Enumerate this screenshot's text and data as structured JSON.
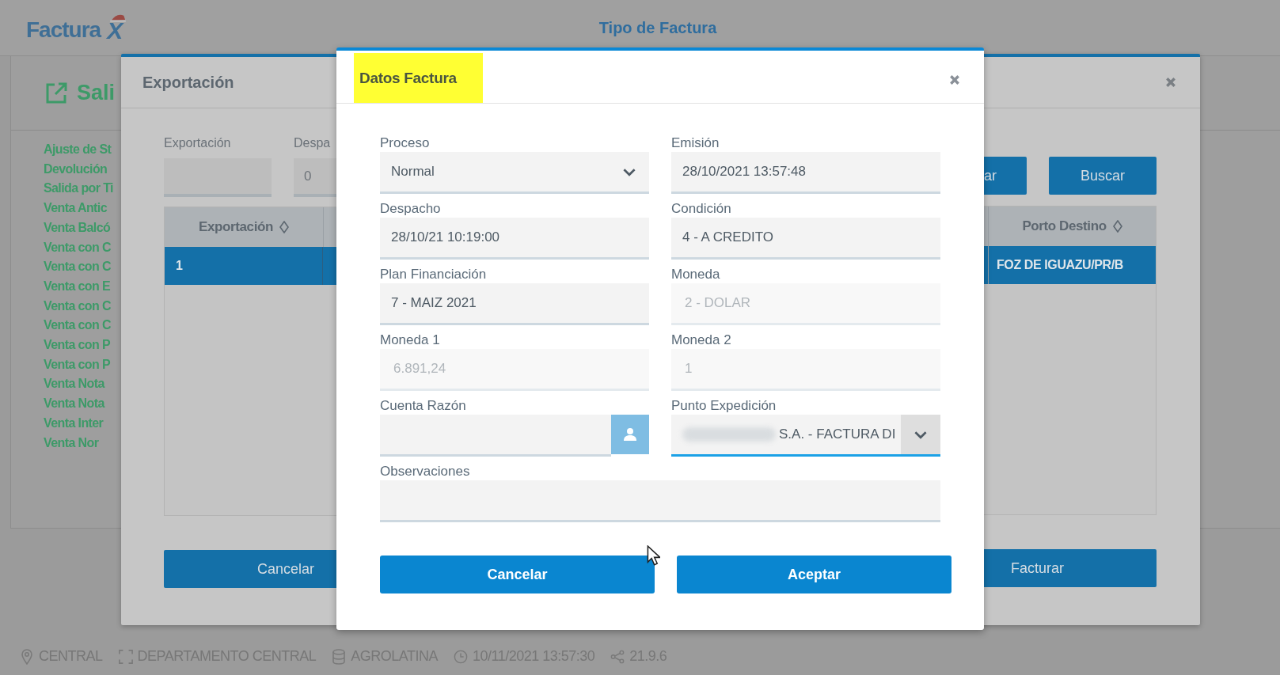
{
  "header": {
    "logo": {
      "text": "Factura",
      "mark": "X"
    },
    "title": "Tipo de Factura"
  },
  "side_panel": {
    "heading": "Sali",
    "items": [
      "Ajuste de St",
      "Devolución",
      "Salida por Ti",
      "Venta Antic",
      "Venta Balcó",
      "Venta con C",
      "Venta con C",
      "Venta con E",
      "Venta con C",
      "Venta con C",
      "Venta con P",
      "Venta con P",
      "Venta Nota",
      "Venta Nota",
      "Venta Inter",
      "Venta Nor"
    ]
  },
  "export_dialog": {
    "title": "Exportación",
    "filters": [
      {
        "label": "Exportación"
      },
      {
        "label": "Despa",
        "value": "0"
      }
    ],
    "actions": [
      "ar",
      "Buscar"
    ],
    "table": {
      "columns": [
        "Exportación",
        "Porto Destino"
      ],
      "rows": [
        {
          "cells": [
            "1",
            "FOZ DE IGUAZU/PR/B"
          ],
          "selected": true
        }
      ]
    },
    "buttons": [
      "Cancelar",
      "Facturar"
    ]
  },
  "invoice_dialog": {
    "title": "Datos Factura",
    "fields": [
      {
        "kind": "select",
        "label": "Proceso",
        "value": "Normal",
        "disabled": false,
        "focused": false,
        "blurred": false
      },
      {
        "kind": "text",
        "label": "Emisión",
        "value": "28/10/2021 13:57:48",
        "disabled": false,
        "focused": false,
        "blurred": false
      },
      {
        "kind": "text",
        "label": "Despacho",
        "value": "28/10/21 10:19:00",
        "disabled": false,
        "focused": false,
        "blurred": false
      },
      {
        "kind": "text",
        "label": "Condición",
        "value": "4 - A CREDITO",
        "disabled": false,
        "focused": false,
        "blurred": false
      },
      {
        "kind": "text",
        "label": "Plan Financiación",
        "value": "7 - MAIZ 2021",
        "disabled": false,
        "focused": false,
        "blurred": false
      },
      {
        "kind": "text",
        "label": "Moneda",
        "value": "2 - DOLAR",
        "disabled": true,
        "focused": false,
        "blurred": false
      },
      {
        "kind": "text",
        "label": "Moneda 1",
        "value": "6.891,24",
        "disabled": true,
        "focused": false,
        "blurred": false
      },
      {
        "kind": "text",
        "label": "Moneda 2",
        "value": "1",
        "disabled": true,
        "focused": false,
        "blurred": false
      },
      {
        "kind": "lookup",
        "label": "Cuenta Razón",
        "disabled": false,
        "focused": false,
        "blurred": false
      },
      {
        "kind": "select",
        "label": "Punto Expedición",
        "value": "S.A. - FACTURA DI",
        "disabled": false,
        "focused": true,
        "blurred": true
      },
      {
        "kind": "textarea",
        "label": "Observaciones",
        "disabled": false,
        "focused": false,
        "blurred": false
      }
    ],
    "buttons": [
      "Cancelar",
      "Aceptar"
    ]
  },
  "status_bar": [
    {
      "kind": "location",
      "text": "CENTRAL"
    },
    {
      "kind": "department",
      "text": "DEPARTAMENTO CENTRAL"
    },
    {
      "kind": "database",
      "text": "AGROLATINA"
    },
    {
      "kind": "clock",
      "text": "10/11/2021 13:57:30"
    },
    {
      "kind": "version",
      "text": "21.9.6"
    }
  ]
}
